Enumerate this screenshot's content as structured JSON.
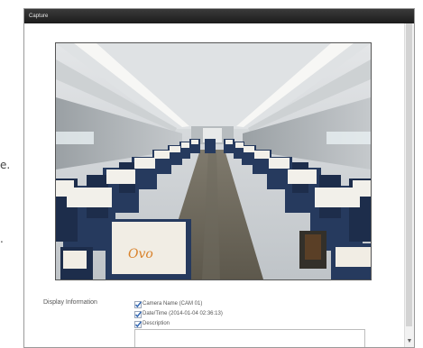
{
  "window": {
    "title": "Capture"
  },
  "side_fragments": {
    "upper": "e.",
    "lower": "."
  },
  "display_information": {
    "label": "Display Information",
    "options": [
      {
        "label": "Camera Name (CAM 01)",
        "checked": true
      },
      {
        "label": "Date/Time (2014-01-04 02:36:13)",
        "checked": true
      },
      {
        "label": "Description",
        "checked": true
      }
    ],
    "description_value": ""
  },
  "image": {
    "subject": "train passenger car interior",
    "headrest_logo": "Ovo"
  },
  "colors": {
    "titlebar": "#2a2a2a",
    "seat_navy": "#263a5e",
    "checkmark": "#2c62b0"
  }
}
